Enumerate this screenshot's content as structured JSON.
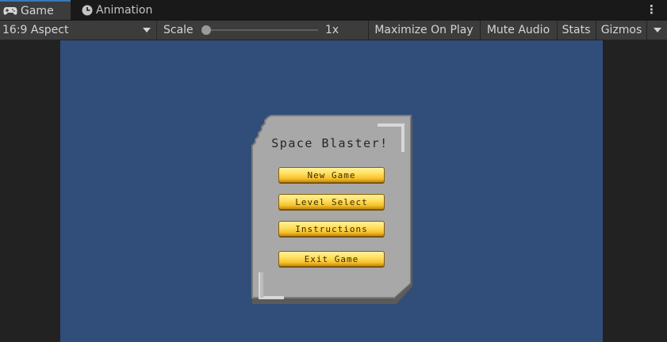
{
  "tabs": [
    {
      "label": "Game",
      "icon": "gamepad-icon",
      "active": true
    },
    {
      "label": "Animation",
      "icon": "clock-icon",
      "active": false
    }
  ],
  "toolbar": {
    "aspect": "16:9 Aspect",
    "scale_label": "Scale",
    "scale_value": "1x",
    "scale_fraction": 0.0,
    "maximize_on_play": "Maximize On Play",
    "mute_audio": "Mute Audio",
    "stats": "Stats",
    "gizmos": "Gizmos"
  },
  "game": {
    "background_color": "#314d79",
    "menu": {
      "title": "Space Blaster!",
      "buttons": [
        {
          "label": "New Game"
        },
        {
          "label": "Level Select"
        },
        {
          "label": "Instructions"
        },
        {
          "label": "Exit Game"
        }
      ]
    }
  }
}
